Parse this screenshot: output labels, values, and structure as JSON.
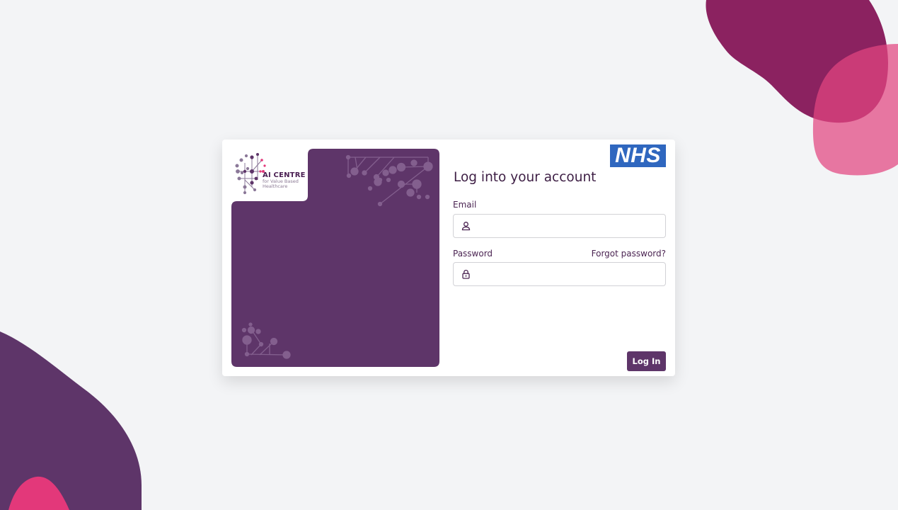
{
  "logo": {
    "name": "AI CENTRE",
    "tagline": "for Value Based Healthcare"
  },
  "nhs_logo": {
    "text": "NHS",
    "color": "#2f67bf"
  },
  "form": {
    "title": "Log into your account",
    "email_label": "Email",
    "email_value": "",
    "password_label": "Password",
    "password_value": "",
    "forgot_password": "Forgot password?",
    "login_button": "Log In"
  },
  "colors": {
    "brand_purple": "#5e3569",
    "pink": "#e3387a",
    "light_pink": "#e57aa0",
    "magenta": "#8b2260",
    "background": "#f3f4f6"
  },
  "icons": [
    "user-icon",
    "lock-icon"
  ]
}
